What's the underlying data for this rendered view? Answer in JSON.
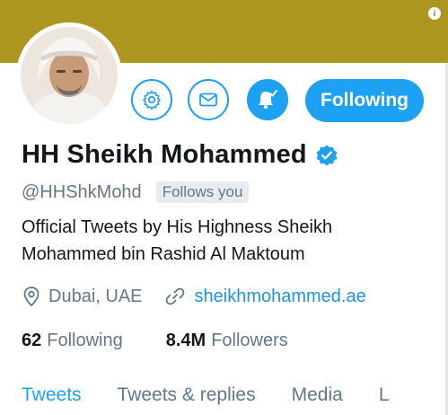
{
  "profile": {
    "name": "HH Sheikh Mohammed",
    "handle": "@HHShkMohd",
    "follows_you": "Follows you",
    "bio": "Official Tweets by His Highness Sheikh Mohammed bin Rashid Al Maktoum",
    "location": "Dubai, UAE",
    "url": "sheikhmohammed.ae"
  },
  "actions": {
    "following_label": "Following"
  },
  "stats": {
    "following_count": "62",
    "following_label": "Following",
    "followers_count": "8.4M",
    "followers_label": "Followers"
  },
  "tabs": [
    {
      "label": "Tweets",
      "active": true
    },
    {
      "label": "Tweets & replies",
      "active": false
    },
    {
      "label": "Media",
      "active": false
    },
    {
      "label": "L",
      "active": false
    }
  ],
  "icons": {
    "info": "info-icon",
    "settings": "gear-icon",
    "message": "envelope-icon",
    "notifications": "bell-check-icon",
    "verified": "verified-badge-icon",
    "location": "location-pin-icon",
    "link": "link-icon"
  },
  "colors": {
    "banner": "#ad9620",
    "accent": "#1da1f2",
    "muted_text": "#657786",
    "link": "#1b95e0",
    "text": "#14171a"
  }
}
